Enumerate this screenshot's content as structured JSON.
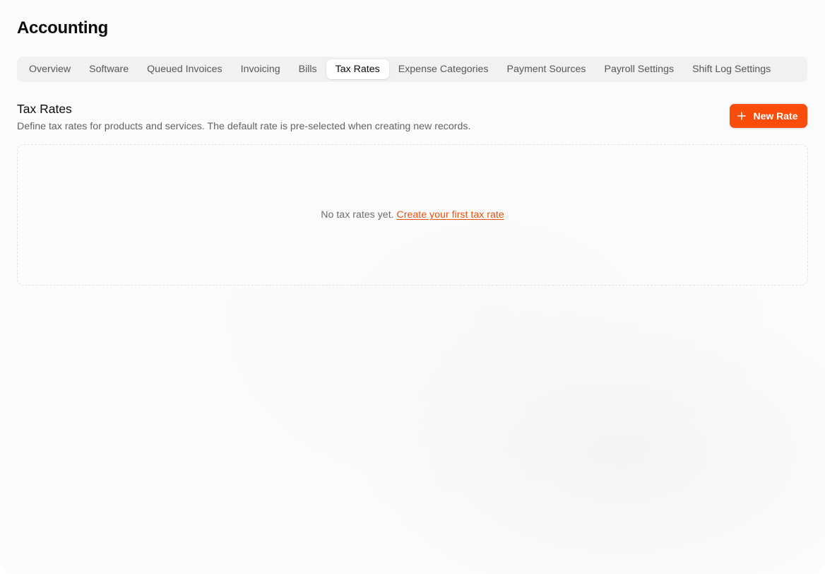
{
  "page": {
    "title": "Accounting"
  },
  "tabs": [
    {
      "label": "Overview",
      "active": false
    },
    {
      "label": "Software",
      "active": false
    },
    {
      "label": "Queued Invoices",
      "active": false
    },
    {
      "label": "Invoicing",
      "active": false
    },
    {
      "label": "Bills",
      "active": false
    },
    {
      "label": "Tax Rates",
      "active": true
    },
    {
      "label": "Expense Categories",
      "active": false
    },
    {
      "label": "Payment Sources",
      "active": false
    },
    {
      "label": "Payroll Settings",
      "active": false
    },
    {
      "label": "Shift Log Settings",
      "active": false
    }
  ],
  "section": {
    "title": "Tax Rates",
    "description": "Define tax rates for products and services. The default rate is pre-selected when creating new records.",
    "new_button_label": "New Rate",
    "new_button_icon": "plus-icon"
  },
  "empty_state": {
    "text": "No tax rates yet.",
    "link_label": "Create your first tax rate"
  },
  "colors": {
    "accent": "#fa4d0c",
    "link": "#e8520f",
    "tab_bar_bg": "#f1f1f1"
  }
}
